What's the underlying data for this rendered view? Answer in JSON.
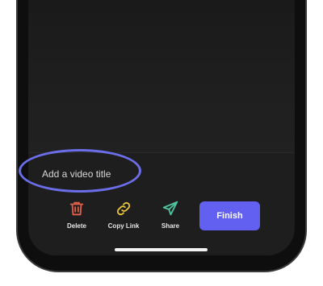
{
  "video": {
    "title_placeholder": "Add a video title"
  },
  "actions": [
    {
      "label": "Delete",
      "icon": "trash-icon",
      "color": "#e0604a"
    },
    {
      "label": "Copy Link",
      "icon": "link-icon",
      "color": "#e7c23a"
    },
    {
      "label": "Share",
      "icon": "send-icon",
      "color": "#4fc4a0"
    }
  ],
  "finish": {
    "label": "Finish",
    "color": "#6160f0"
  },
  "annotation": {
    "ring_color": "#6b6ee8"
  }
}
